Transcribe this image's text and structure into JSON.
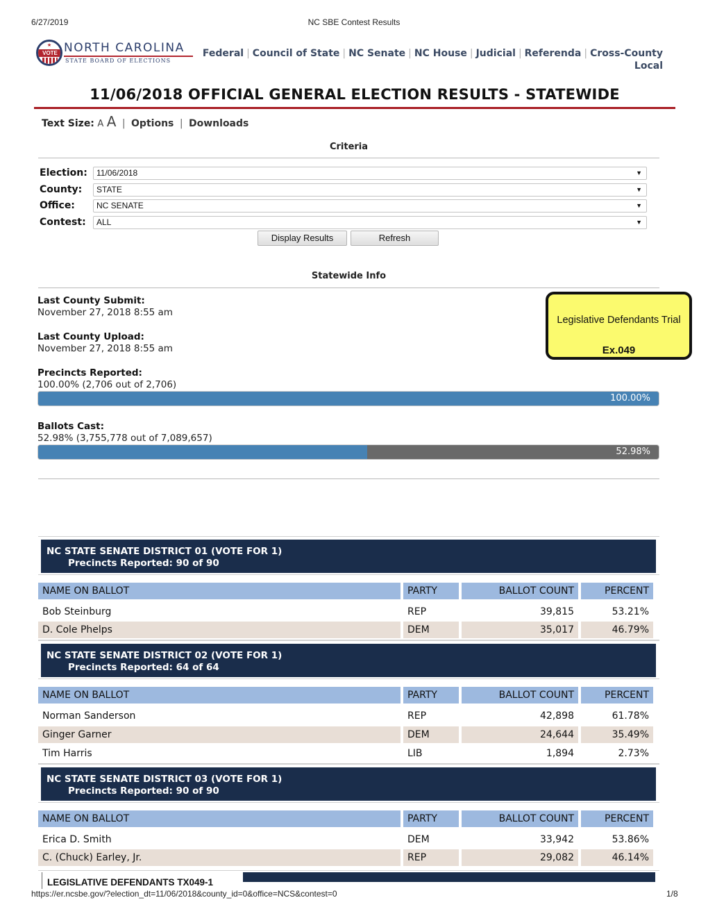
{
  "print_header": {
    "date": "6/27/2019",
    "title": "NC SBE Contest Results"
  },
  "logo": {
    "seal_text": "VOTE",
    "line1": "NORTH CAROLINA",
    "line2": "STATE BOARD OF ELECTIONS"
  },
  "nav": [
    {
      "label": "Federal"
    },
    {
      "label": "Council of State"
    },
    {
      "label": "NC Senate"
    },
    {
      "label": "NC House"
    },
    {
      "label": "Judicial"
    },
    {
      "label": "Referenda"
    },
    {
      "label": "Cross-County Local"
    }
  ],
  "page_title": "11/06/2018 OFFICIAL GENERAL ELECTION RESULTS - STATEWIDE",
  "toolbar": {
    "text_size_label": "Text Size:",
    "a_small": "A",
    "a_large": "A",
    "options": "Options",
    "downloads": "Downloads",
    "separator": "|"
  },
  "criteria": {
    "heading": "Criteria",
    "fields": [
      {
        "label": "Election:",
        "value": "11/06/2018"
      },
      {
        "label": "County:",
        "value": "STATE"
      },
      {
        "label": "Office:",
        "value": "NC SENATE"
      },
      {
        "label": "Contest:",
        "value": "ALL"
      }
    ],
    "display_button": "Display Results",
    "refresh_button": "Refresh"
  },
  "statewide": {
    "heading": "Statewide Info",
    "last_submit_label": "Last County Submit:",
    "last_submit": "November 27, 2018 8:55 am",
    "last_upload_label": "Last County Upload:",
    "last_upload": "November 27, 2018 8:55 am",
    "precincts_label": "Precincts Reported:",
    "precincts": "100.00% (2,706 out of 2,706)",
    "precincts_pct": 100.0,
    "precincts_bar_label": "100.00%",
    "ballots_label": "Ballots Cast:",
    "ballots": "52.98% (3,755,778 out of 7,089,657)",
    "ballots_pct": 52.98,
    "ballots_bar_label": "52.98%"
  },
  "exhibit": {
    "line1": "Legislative Defendants Trial",
    "line2": "Ex.049"
  },
  "columns": [
    "NAME ON BALLOT",
    "PARTY",
    "BALLOT COUNT",
    "PERCENT"
  ],
  "contests": [
    {
      "title": "NC STATE SENATE DISTRICT 01 (VOTE FOR 1)",
      "precincts": "Precincts Reported: 90 of 90",
      "rows": [
        {
          "name": "Bob Steinburg",
          "party": "REP",
          "count": "39,815",
          "percent": "53.21%"
        },
        {
          "name": "D. Cole Phelps",
          "party": "DEM",
          "count": "35,017",
          "percent": "46.79%"
        }
      ]
    },
    {
      "title": "NC STATE SENATE DISTRICT 02 (VOTE FOR 1)",
      "precincts": "Precincts Reported: 64 of 64",
      "rows": [
        {
          "name": "Norman Sanderson",
          "party": "REP",
          "count": "42,898",
          "percent": "61.78%"
        },
        {
          "name": "Ginger Garner",
          "party": "DEM",
          "count": "24,644",
          "percent": "35.49%"
        },
        {
          "name": "Tim Harris",
          "party": "LIB",
          "count": "1,894",
          "percent": "2.73%"
        }
      ]
    },
    {
      "title": "NC STATE SENATE DISTRICT 03 (VOTE FOR 1)",
      "precincts": "Precincts Reported: 90 of 90",
      "rows": [
        {
          "name": "Erica D. Smith",
          "party": "DEM",
          "count": "33,942",
          "percent": "53.86%"
        },
        {
          "name": "C. (Chuck) Earley, Jr.",
          "party": "REP",
          "count": "29,082",
          "percent": "46.14%"
        }
      ]
    }
  ],
  "stamp": "LEGISLATIVE DEFENDANTS TX049-1",
  "footer": {
    "url": "https://er.ncsbe.gov/?election_dt=11/06/2018&county_id=0&office=NCS&contest=0",
    "page": "1/8"
  }
}
